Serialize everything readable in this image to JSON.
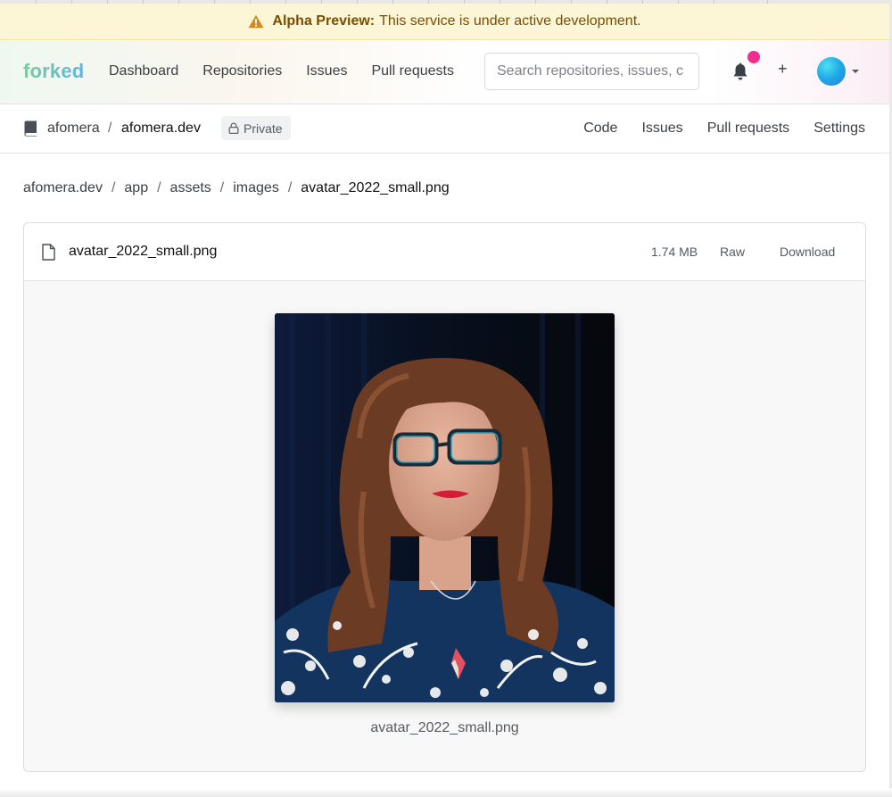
{
  "banner": {
    "label": "Alpha Preview:",
    "message": "This service is under active development."
  },
  "header": {
    "logo": "forked",
    "nav": [
      "Dashboard",
      "Repositories",
      "Issues",
      "Pull requests"
    ],
    "search_placeholder": "Search repositories, issues, c",
    "plus_label": "+"
  },
  "repo": {
    "owner": "afomera",
    "separator": "/",
    "name": "afomera.dev",
    "visibility": "Private",
    "tabs": [
      "Code",
      "Issues",
      "Pull requests",
      "Settings"
    ]
  },
  "breadcrumb": {
    "parts": [
      "afomera.dev",
      "app",
      "assets",
      "images"
    ],
    "current": "avatar_2022_small.png",
    "separator": "/"
  },
  "file": {
    "name": "avatar_2022_small.png",
    "size": "1.74 MB",
    "raw_label": "Raw",
    "download_label": "Download",
    "caption": "avatar_2022_small.png"
  },
  "colors": {
    "banner_bg": "#fcf6d6",
    "banner_text": "#7a4d00",
    "notification_dot": "#ee2f8d",
    "logo_gradient_start": "#7cc99a",
    "logo_gradient_end": "#5fb3e6"
  },
  "icons": {
    "banner": "warning-icon",
    "notifications": "bell-icon",
    "repo": "repo-book-icon",
    "private": "lock-icon",
    "file": "file-icon"
  }
}
